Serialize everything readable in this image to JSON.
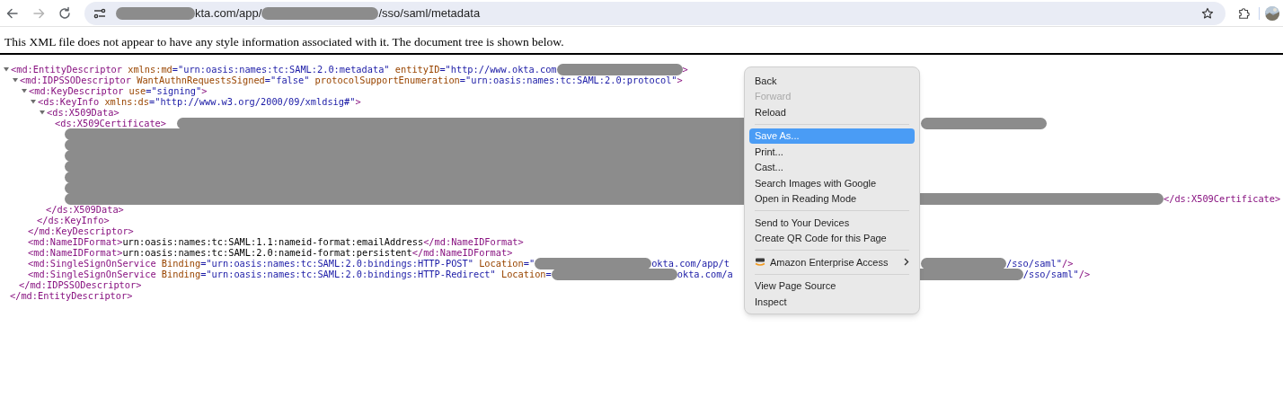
{
  "browser": {
    "nav": [
      {
        "kind": "back",
        "disabled": false
      },
      {
        "kind": "forward",
        "disabled": true
      },
      {
        "kind": "reload",
        "disabled": false
      }
    ],
    "address": [
      {
        "kind": "redacted"
      },
      {
        "kind": "text",
        "text": "kta.com/app/"
      },
      {
        "kind": "redacted"
      },
      {
        "kind": "text",
        "text": "/sso/saml/metadata"
      }
    ]
  },
  "notice": "This XML file does not appear to have any style information associated with it. The document tree is shown below.",
  "xml_tree": [
    {
      "open": [
        {
          "kind": "tag",
          "text": "<md:EntityDescriptor"
        },
        {
          "kind": "attr",
          "text": " xmlns:md"
        },
        {
          "kind": "value",
          "text": "=\"urn:oasis:names:tc:SAML:2.0:metadata\""
        },
        {
          "kind": "attr",
          "text": " entityID"
        },
        {
          "kind": "value",
          "text": "=\"http://www.okta.com"
        },
        {
          "kind": "redacted"
        },
        {
          "kind": "tag",
          "text": ">"
        }
      ],
      "expanded": true,
      "close": [
        {
          "kind": "tag",
          "text": "</md:EntityDescriptor>"
        }
      ],
      "children": [
        {
          "open": [
            {
              "kind": "tag",
              "text": "<md:IDPSSODescriptor"
            },
            {
              "kind": "attr",
              "text": " WantAuthnRequestsSigned"
            },
            {
              "kind": "value",
              "text": "=\"false\""
            },
            {
              "kind": "attr",
              "text": " protocolSupportEnumeration"
            },
            {
              "kind": "value",
              "text": "=\"urn:oasis:names:tc:SAML:2.0:protocol\""
            },
            {
              "kind": "tag",
              "text": ">"
            }
          ],
          "expanded": true,
          "close": [
            {
              "kind": "tag",
              "text": "</md:IDPSSODescriptor>"
            }
          ],
          "children": [
            {
              "open": [
                {
                  "kind": "tag",
                  "text": "<md:KeyDescriptor"
                },
                {
                  "kind": "attr",
                  "text": " use"
                },
                {
                  "kind": "value",
                  "text": "=\"signing\""
                },
                {
                  "kind": "tag",
                  "text": ">"
                }
              ],
              "expanded": true,
              "close": [
                {
                  "kind": "tag",
                  "text": "</md:KeyDescriptor>"
                }
              ],
              "children": [
                {
                  "open": [
                    {
                      "kind": "tag",
                      "text": "<ds:KeyInfo"
                    },
                    {
                      "kind": "attr",
                      "text": " xmlns:ds"
                    },
                    {
                      "kind": "value",
                      "text": "=\"http://www.w3.org/2000/09/xmldsig#\""
                    },
                    {
                      "kind": "tag",
                      "text": ">"
                    }
                  ],
                  "expanded": true,
                  "close": [
                    {
                      "kind": "tag",
                      "text": "</ds:KeyInfo>"
                    }
                  ],
                  "children": [
                    {
                      "open": [
                        {
                          "kind": "tag",
                          "text": "<ds:X509Data>"
                        }
                      ],
                      "expanded": true,
                      "close": [
                        {
                          "kind": "tag",
                          "text": "</ds:X509Data>"
                        }
                      ],
                      "children": [
                        {
                          "lines": [
                            [
                              {
                                "kind": "tag",
                                "text": "<ds:X509Certificate>"
                              },
                              {
                                "kind": "redacted"
                              },
                              {
                                "kind": "redacted"
                              }
                            ],
                            [
                              {
                                "kind": "redacted"
                              }
                            ],
                            [
                              {
                                "kind": "redacted"
                              }
                            ],
                            [
                              {
                                "kind": "redacted"
                              }
                            ],
                            [
                              {
                                "kind": "redacted"
                              }
                            ],
                            [
                              {
                                "kind": "redacted"
                              }
                            ],
                            [
                              {
                                "kind": "redacted"
                              }
                            ],
                            [
                              {
                                "kind": "redacted"
                              },
                              {
                                "kind": "redacted"
                              },
                              {
                                "kind": "tag",
                                "text": "</ds:X509Certificate>"
                              }
                            ]
                          ]
                        }
                      ]
                    }
                  ]
                }
              ]
            },
            {
              "lines": [
                [
                  {
                    "kind": "tag",
                    "text": "<md:NameIDFormat>"
                  },
                  {
                    "kind": "text",
                    "text": "urn:oasis:names:tc:SAML:1.1:nameid-format:emailAddress"
                  },
                  {
                    "kind": "tag",
                    "text": "</md:NameIDFormat>"
                  }
                ]
              ]
            },
            {
              "lines": [
                [
                  {
                    "kind": "tag",
                    "text": "<md:NameIDFormat>"
                  },
                  {
                    "kind": "text",
                    "text": "urn:oasis:names:tc:SAML:2.0:nameid-format:persistent"
                  },
                  {
                    "kind": "tag",
                    "text": "</md:NameIDFormat>"
                  }
                ]
              ]
            },
            {
              "lines": [
                [
                  {
                    "kind": "tag",
                    "text": "<md:SingleSignOnService"
                  },
                  {
                    "kind": "attr",
                    "text": " Binding"
                  },
                  {
                    "kind": "value",
                    "text": "=\"urn:oasis:names:tc:SAML:2.0:bindings:HTTP-POST\""
                  },
                  {
                    "kind": "attr",
                    "text": " Location"
                  },
                  {
                    "kind": "value",
                    "text": "=\""
                  },
                  {
                    "kind": "redacted"
                  },
                  {
                    "kind": "value",
                    "text": "okta.com/app/t"
                  },
                  {
                    "kind": "redacted"
                  },
                  {
                    "kind": "value",
                    "text": "/sso/saml\""
                  },
                  {
                    "kind": "tag",
                    "text": "/>"
                  }
                ]
              ]
            },
            {
              "lines": [
                [
                  {
                    "kind": "tag",
                    "text": "<md:SingleSignOnService"
                  },
                  {
                    "kind": "attr",
                    "text": " Binding"
                  },
                  {
                    "kind": "value",
                    "text": "=\"urn:oasis:names:tc:SAML:2.0:bindings:HTTP-Redirect\""
                  },
                  {
                    "kind": "attr",
                    "text": " Location"
                  },
                  {
                    "kind": "value",
                    "text": "="
                  },
                  {
                    "kind": "redacted"
                  },
                  {
                    "kind": "value",
                    "text": "okta.com/a"
                  },
                  {
                    "kind": "redacted"
                  },
                  {
                    "kind": "value",
                    "text": "/sso/saml\""
                  },
                  {
                    "kind": "tag",
                    "text": "/>"
                  }
                ]
              ]
            }
          ]
        }
      ]
    }
  ],
  "context_menu": [
    [
      {
        "label": "Back",
        "disabled": false,
        "selected": false
      },
      {
        "label": "Forward",
        "disabled": true,
        "selected": false
      },
      {
        "label": "Reload",
        "disabled": false,
        "selected": false
      }
    ],
    [
      {
        "label": "Save As...",
        "disabled": false,
        "selected": true
      },
      {
        "label": "Print...",
        "disabled": false,
        "selected": false
      },
      {
        "label": "Cast...",
        "disabled": false,
        "selected": false
      },
      {
        "label": "Search Images with Google",
        "disabled": false,
        "selected": false
      },
      {
        "label": "Open in Reading Mode",
        "disabled": false,
        "selected": false
      }
    ],
    [
      {
        "label": "Send to Your Devices",
        "disabled": false,
        "selected": false
      },
      {
        "label": "Create QR Code for this Page",
        "disabled": false,
        "selected": false
      }
    ],
    [
      {
        "label": "Amazon Enterprise Access",
        "disabled": false,
        "selected": false,
        "icon": true,
        "submenu": true
      }
    ],
    [
      {
        "label": "View Page Source",
        "disabled": false,
        "selected": false
      },
      {
        "label": "Inspect",
        "disabled": false,
        "selected": false
      }
    ]
  ]
}
